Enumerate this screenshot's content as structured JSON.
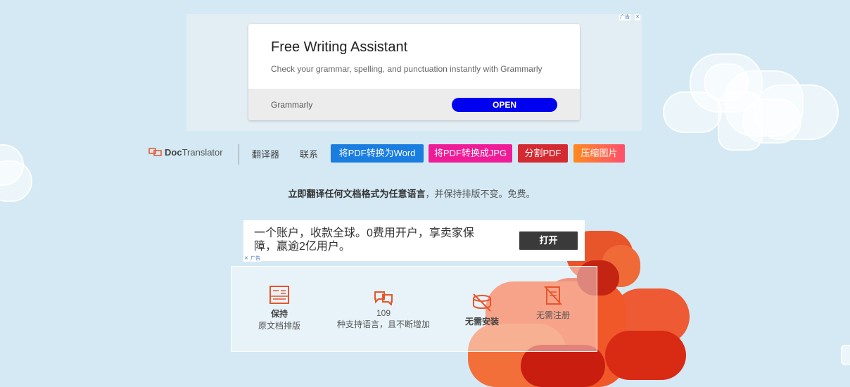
{
  "top_ad": {
    "title": "Free Writing Assistant",
    "description": "Check your grammar, spelling, and punctuation instantly with Grammarly",
    "brand": "Grammarly",
    "open_label": "OPEN"
  },
  "nav": {
    "logo_prefix": "Doc",
    "logo_suffix": "Translator",
    "links": [
      "翻译器",
      "联系"
    ],
    "buttons": [
      {
        "label": "将PDF转换为Word",
        "color": "#1a7de0"
      },
      {
        "label": "将PDF转换成JPG",
        "color": "#f01b97"
      },
      {
        "label": "分割PDF",
        "color": "#d42b33"
      },
      {
        "label": "压缩图片",
        "color": "#ff7a2e"
      }
    ]
  },
  "tagline": {
    "bold": "立即翻译任何文档格式为任意语言",
    "rest": "，并保持排版不变。免费。"
  },
  "mid_ad": {
    "text": "一个账户，收款全球。0费用开户，享卖家保障，赢逾2亿用户。",
    "open_label": "打开"
  },
  "features": [
    {
      "title": "保持",
      "subtitle": "原文档排版",
      "icon": "layout-icon"
    },
    {
      "title": "109",
      "subtitle": "种支持语言，且不断增加",
      "icon": "translate-icon"
    },
    {
      "title": "无需安装",
      "subtitle": "",
      "icon": "no-install-icon"
    },
    {
      "title": "无需注册",
      "subtitle": "",
      "icon": "no-register-icon"
    }
  ],
  "colors": {
    "background": "#d4e9f4",
    "accent_orange": "#e8552b"
  }
}
